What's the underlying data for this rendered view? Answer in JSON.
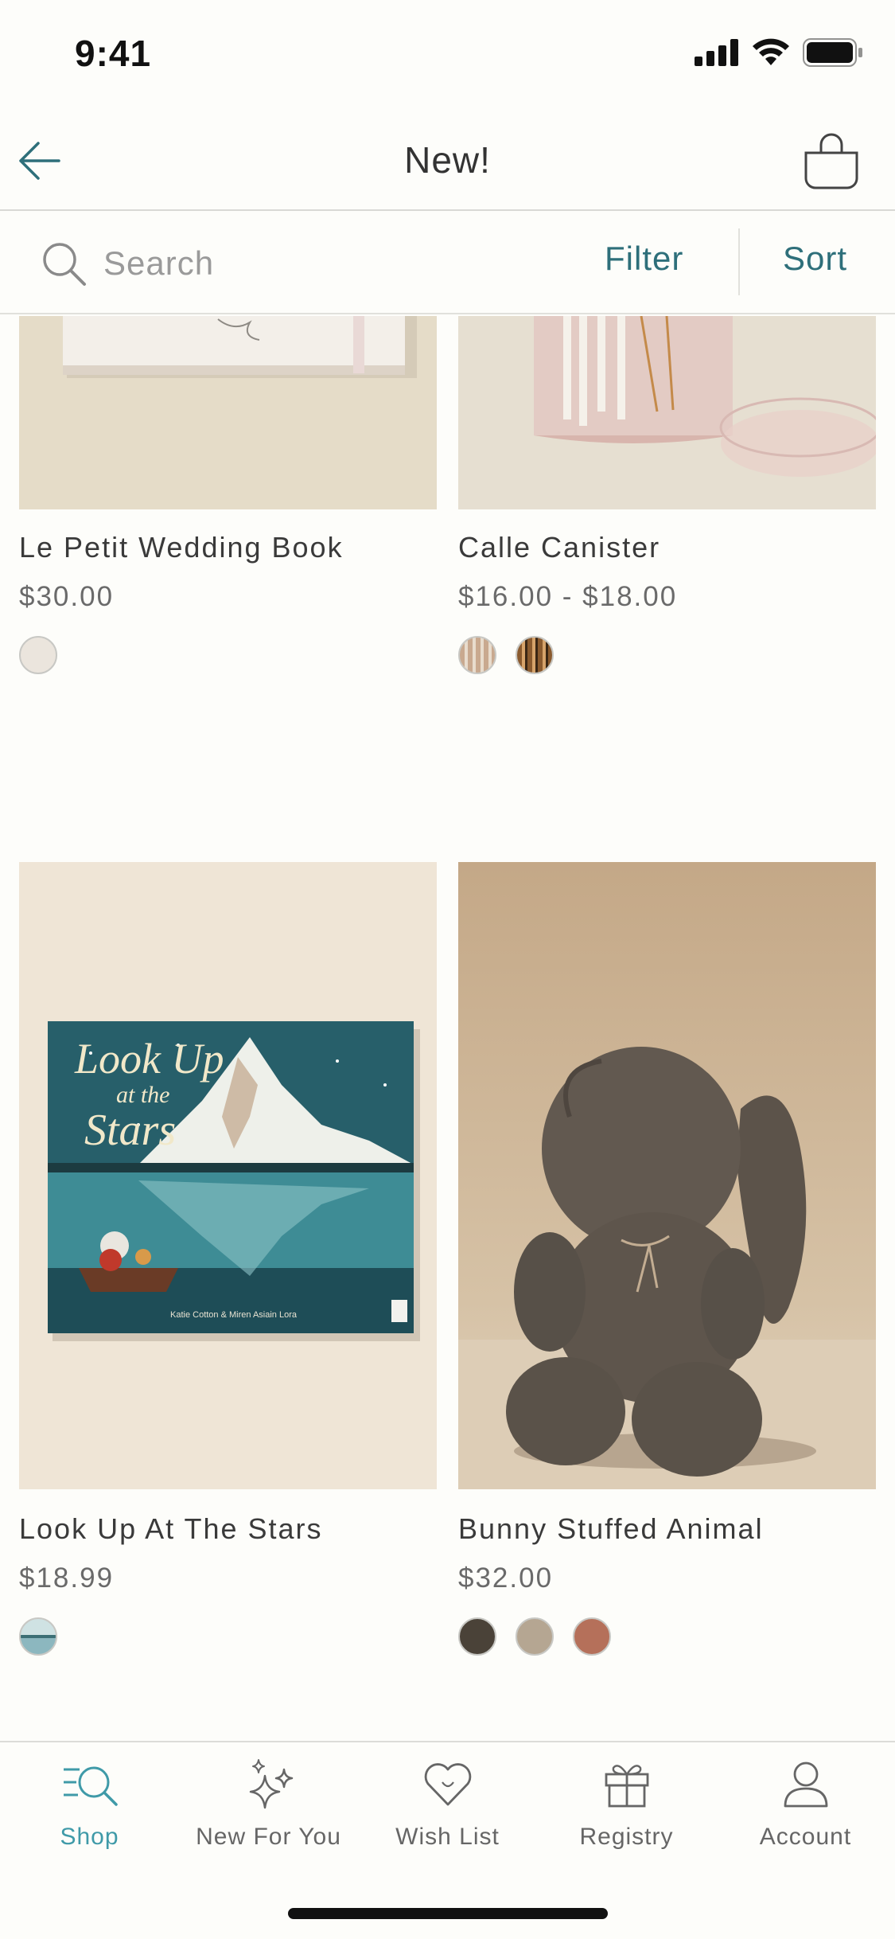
{
  "status_bar": {
    "time": "9:41"
  },
  "header": {
    "title": "New!"
  },
  "search": {
    "placeholder": "Search",
    "filter_label": "Filter",
    "sort_label": "Sort"
  },
  "products": [
    {
      "name": "Le Petit Wedding Book",
      "price": "$30.00",
      "swatch_colors": [
        "#e8e2da"
      ]
    },
    {
      "name": "Calle Canister",
      "price": "$16.00 - $18.00",
      "swatch_colors": [
        "#c9a98f",
        "#8a5a2e"
      ]
    },
    {
      "name": "Look Up At The Stars",
      "price": "$18.99",
      "swatch_colors": [
        "#8cb7bf"
      ]
    },
    {
      "name": "Bunny Stuffed Animal",
      "price": "$32.00",
      "swatch_colors": [
        "#4a4238",
        "#b5a692",
        "#b5705a"
      ]
    }
  ],
  "book_cover": {
    "title_line1": "Look Up",
    "title_line2": "at the",
    "title_line3": "Stars",
    "authors": "Katie Cotton & Miren Asiain Lora"
  },
  "tabs": [
    {
      "label": "Shop",
      "icon": "shop-search-icon",
      "active": true
    },
    {
      "label": "New For You",
      "icon": "sparkles-icon",
      "active": false
    },
    {
      "label": "Wish List",
      "icon": "heart-icon",
      "active": false
    },
    {
      "label": "Registry",
      "icon": "gift-icon",
      "active": false
    },
    {
      "label": "Account",
      "icon": "person-icon",
      "active": false
    }
  ],
  "colors": {
    "accent": "#2e6f7a",
    "active_tab": "#3f9aa8",
    "background": "#fdfdfa"
  }
}
